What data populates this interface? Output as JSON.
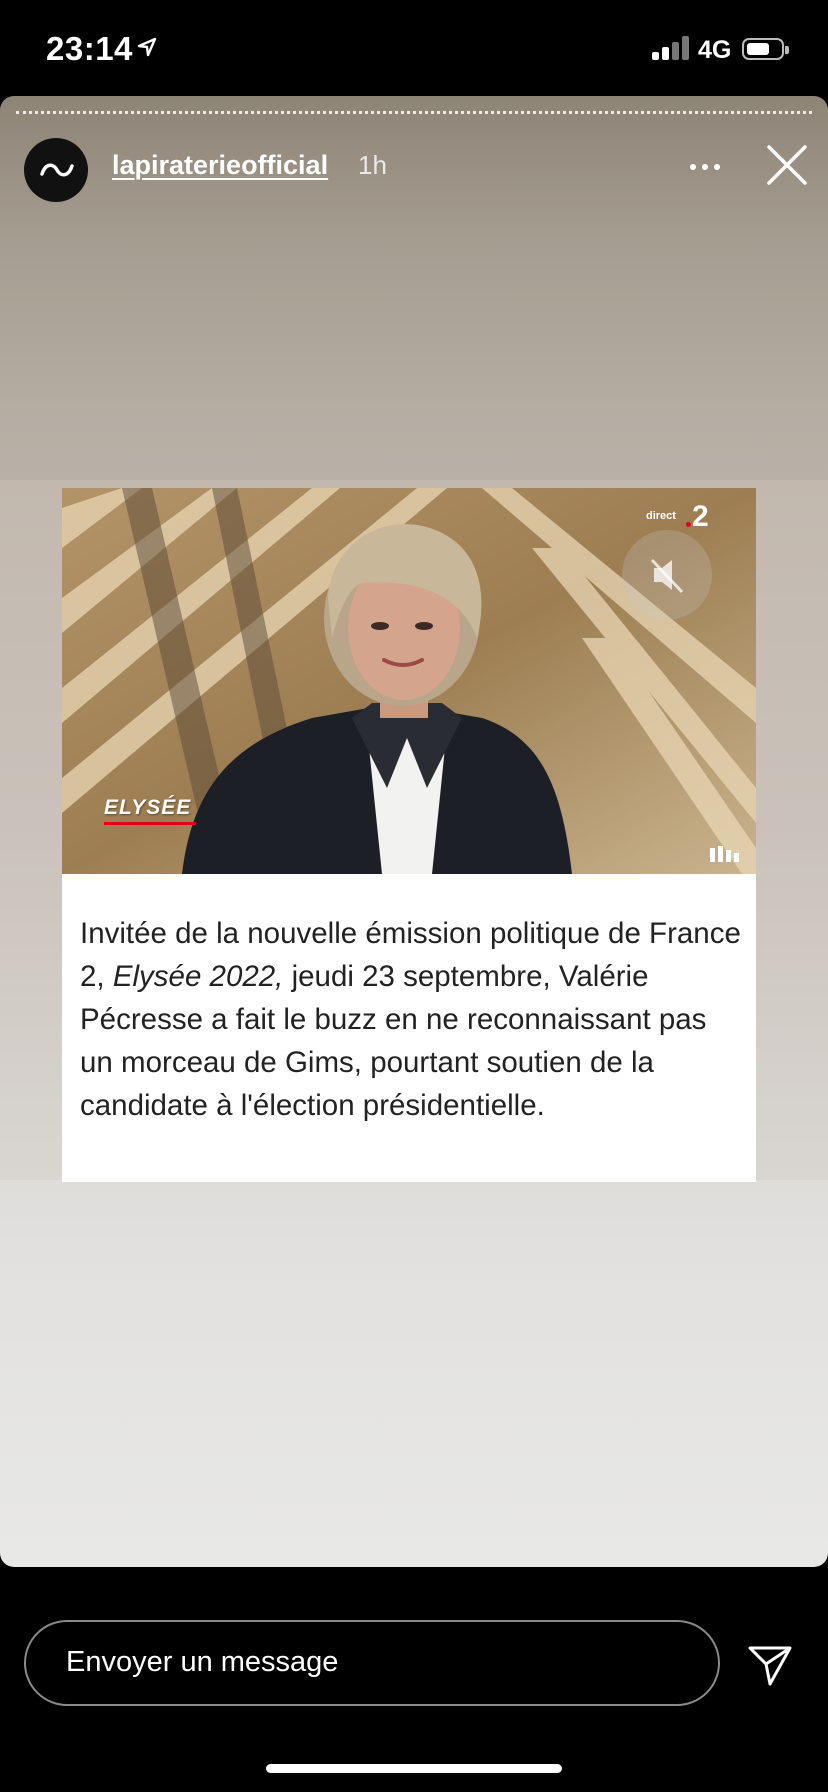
{
  "status_bar": {
    "time": "23:14",
    "network": "4G",
    "location_icon": "location-arrow-icon",
    "signal_icon": "cellular-signal-icon",
    "battery_icon": "battery-icon"
  },
  "story": {
    "username": "lapiraterieofficial",
    "time_ago": "1h",
    "avatar_icon": "tilde-logo-icon",
    "more_icon": "more-dots-icon",
    "close_icon": "close-icon"
  },
  "post": {
    "photo": {
      "channel_badge": "direct",
      "channel_number": "2",
      "show_label": "ELYSÉE",
      "mute_icon": "muted-speaker-icon",
      "bars_icon": "sound-bars-icon"
    },
    "caption": {
      "before": "Invitée de la nouvelle émission politique de France 2, ",
      "italic": "Elysée 2022,",
      "after": " jeudi 23 septembre, Valérie Pécresse a fait le buzz en ne reconnaissant pas un morceau de Gims, pourtant soutien de la candidate à l'élection présidentielle."
    }
  },
  "message_bar": {
    "placeholder": "Envoyer un message",
    "send_icon": "send-paper-plane-icon"
  },
  "colors": {
    "background": "#000000",
    "story_top": "#8d8476",
    "story_bottom": "#e8e8e7",
    "caption_text": "#222222",
    "accent_red": "#e0001a"
  }
}
